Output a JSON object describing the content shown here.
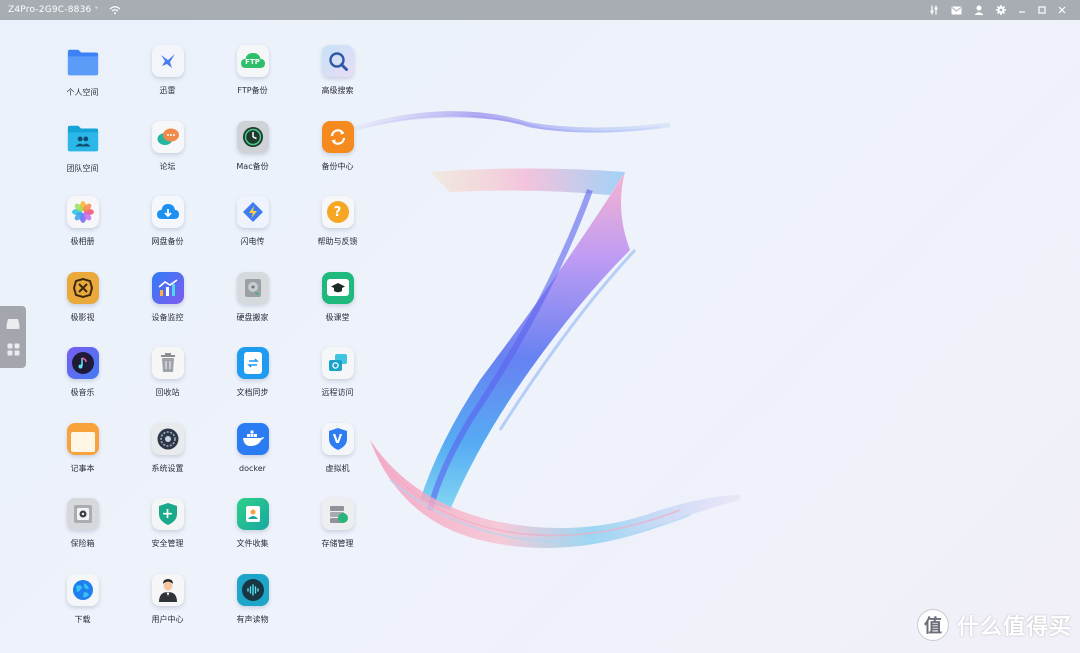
{
  "titlebar": {
    "device_name": "Z4Pro-2G9C-8836",
    "chevron": "˅",
    "icons": [
      "sliders-icon",
      "message-icon",
      "user-icon",
      "gear-icon",
      "minimize-icon",
      "maximize-icon",
      "close-icon"
    ]
  },
  "apps": [
    {
      "label": "个人空间",
      "icon": "folder-icon"
    },
    {
      "label": "迅雷",
      "icon": "bird-icon"
    },
    {
      "label": "FTP备份",
      "icon": "ftp-cloud-icon",
      "glyph": "FTP"
    },
    {
      "label": "高级搜索",
      "icon": "magnifier-icon"
    },
    {
      "label": "团队空间",
      "icon": "team-folder-icon"
    },
    {
      "label": "论坛",
      "icon": "chat-bubble-icon"
    },
    {
      "label": "Mac备份",
      "icon": "time-machine-icon"
    },
    {
      "label": "备份中心",
      "icon": "sync-icon"
    },
    {
      "label": "极相册",
      "icon": "photos-flower-icon"
    },
    {
      "label": "网盘备份",
      "icon": "cloud-download-icon"
    },
    {
      "label": "闪电传",
      "icon": "lightning-icon"
    },
    {
      "label": "帮助与反馈",
      "icon": "help-icon",
      "glyph": "?"
    },
    {
      "label": "极影视",
      "icon": "film-icon"
    },
    {
      "label": "设备监控",
      "icon": "chart-monitor-icon"
    },
    {
      "label": "硬盘搬家",
      "icon": "hard-disk-icon"
    },
    {
      "label": "极课堂",
      "icon": "graduation-cap-icon"
    },
    {
      "label": "极音乐",
      "icon": "music-note-icon"
    },
    {
      "label": "回收站",
      "icon": "trash-icon"
    },
    {
      "label": "文档同步",
      "icon": "doc-sync-icon"
    },
    {
      "label": "远程访问",
      "icon": "remote-access-icon"
    },
    {
      "label": "记事本",
      "icon": "notepad-icon"
    },
    {
      "label": "系统设置",
      "icon": "system-settings-icon"
    },
    {
      "label": "docker",
      "icon": "docker-whale-icon"
    },
    {
      "label": "虚拟机",
      "icon": "vm-shield-icon",
      "glyph": "V"
    },
    {
      "label": "保险箱",
      "icon": "safe-icon"
    },
    {
      "label": "安全管理",
      "icon": "security-shield-icon",
      "glyph": "+"
    },
    {
      "label": "文件收集",
      "icon": "file-collect-icon"
    },
    {
      "label": "存储管理",
      "icon": "storage-icon"
    },
    {
      "label": "下载",
      "icon": "globe-download-icon"
    },
    {
      "label": "用户中心",
      "icon": "user-avatar-icon"
    },
    {
      "label": "有声读物",
      "icon": "audiobook-icon"
    }
  ],
  "dock": {
    "items": [
      "drive-icon",
      "apps-grid-icon"
    ]
  },
  "watermark": {
    "symbol": "值",
    "text": "什么值得买"
  },
  "colors": {
    "titlebar": "#a8acb3",
    "background": "#eef2fa",
    "dock": "#a3a7ad"
  }
}
